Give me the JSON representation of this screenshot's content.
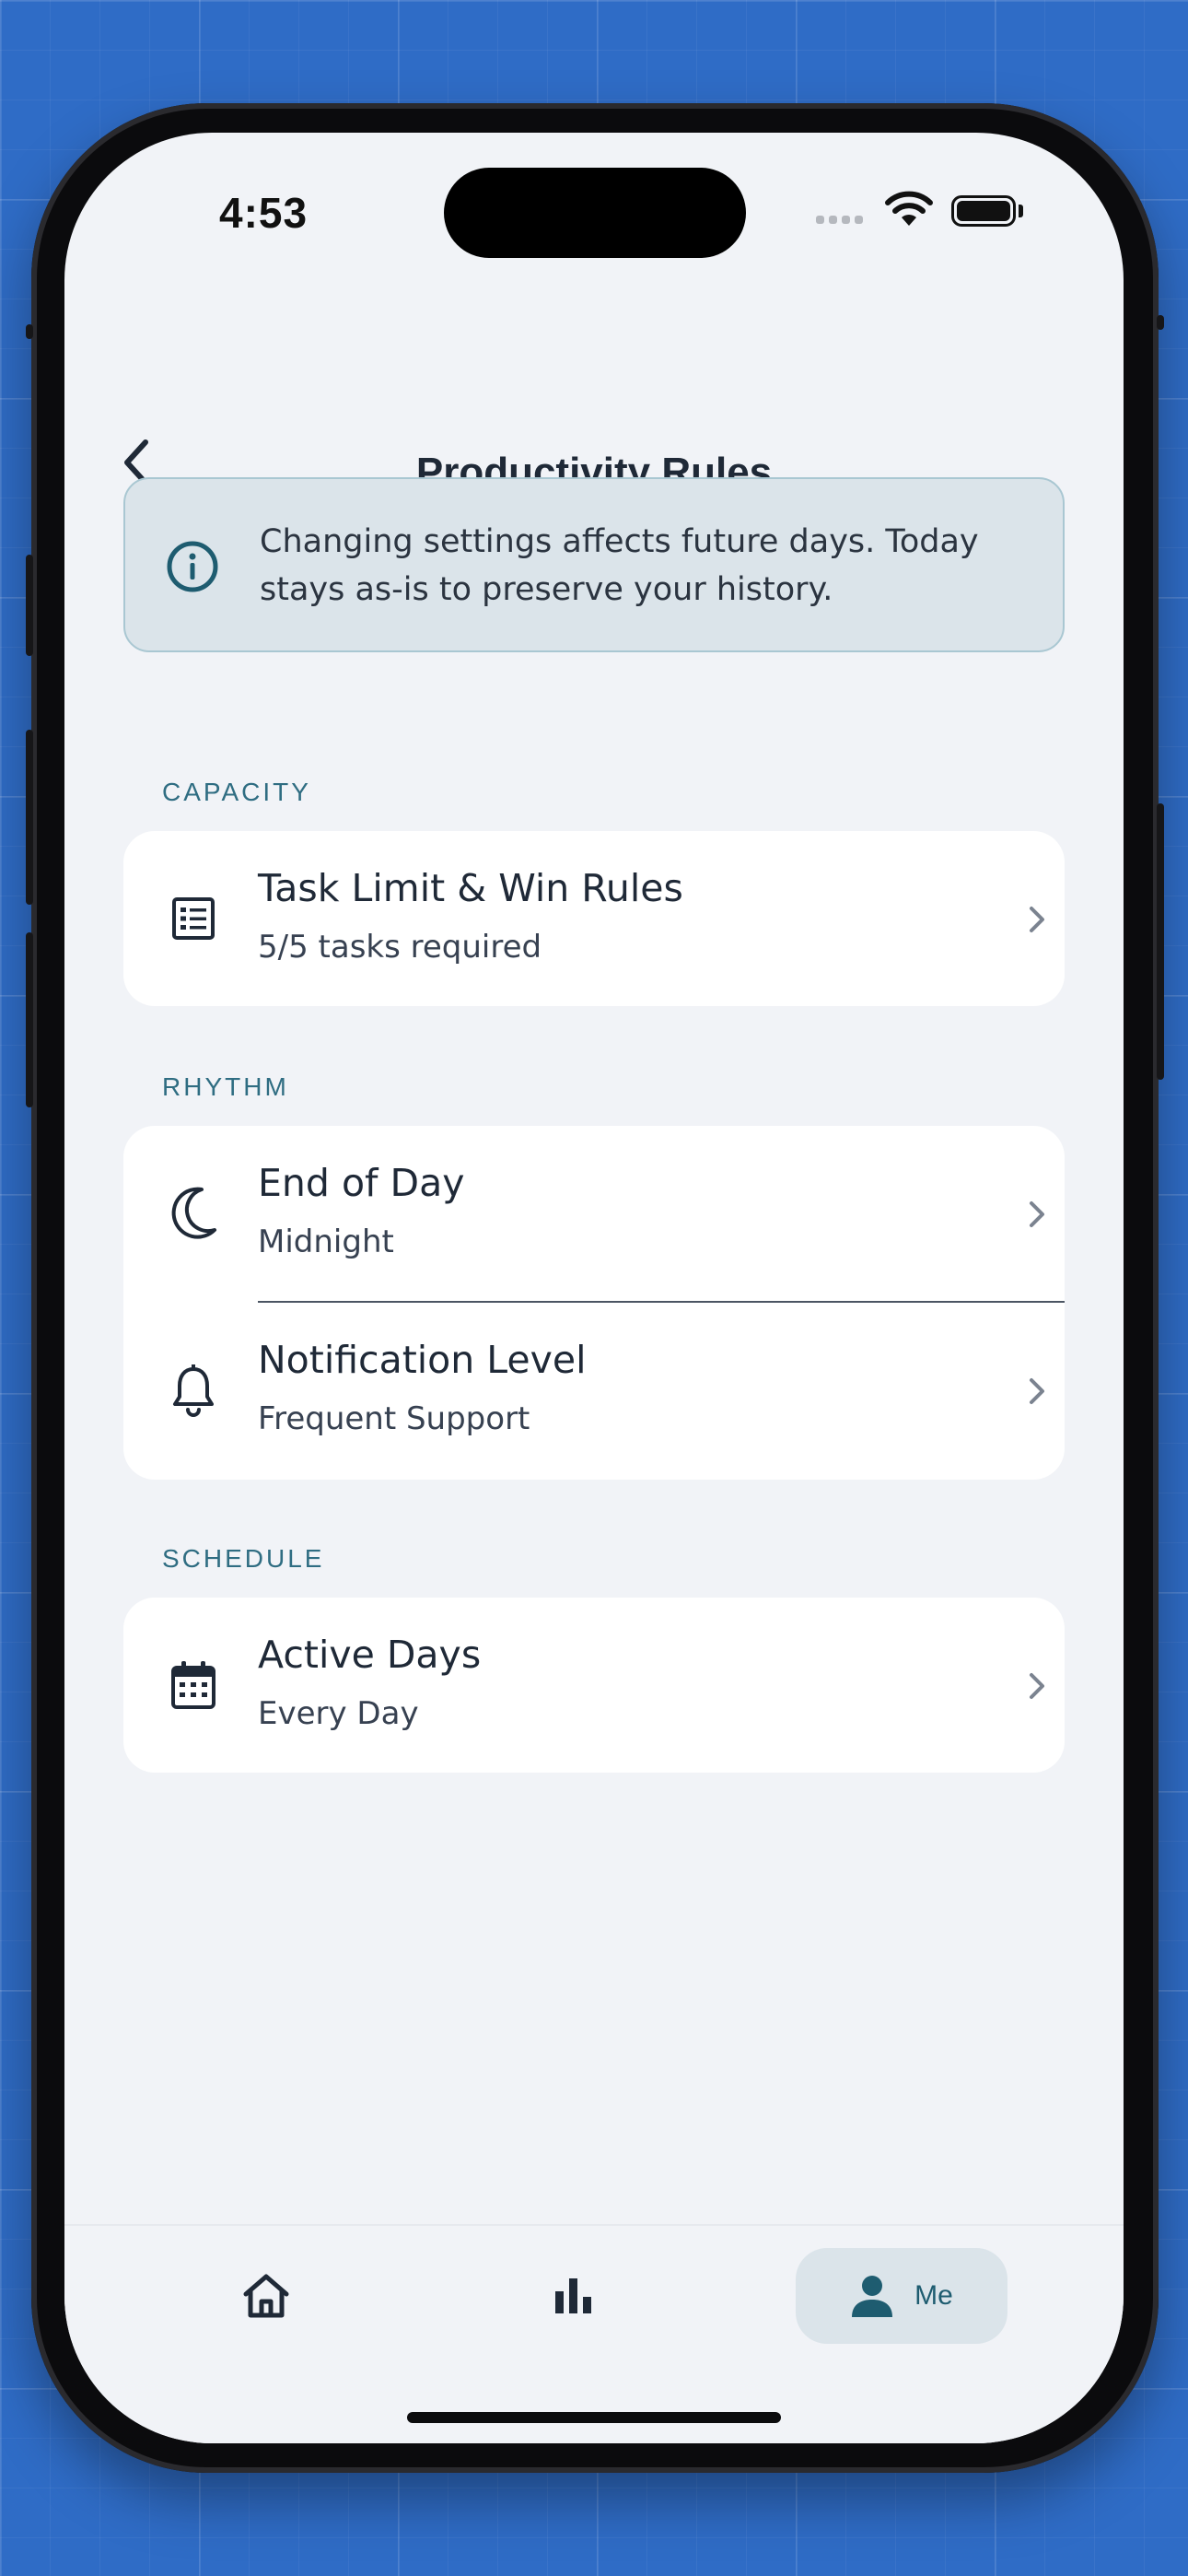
{
  "status_bar": {
    "time": "4:53"
  },
  "header": {
    "title": "Productivity Rules",
    "back_icon": "chevron-left-icon"
  },
  "info_banner": {
    "icon": "info-circle-icon",
    "text": "Changing settings affects future days. Today stays as-is to preserve your history."
  },
  "sections": {
    "capacity": {
      "label": "CAPACITY",
      "rows": [
        {
          "icon": "list-icon",
          "title": "Task Limit & Win Rules",
          "subtitle": "5/5 tasks required"
        }
      ]
    },
    "rhythm": {
      "label": "RHYTHM",
      "rows": [
        {
          "icon": "moon-icon",
          "title": "End of Day",
          "subtitle": "Midnight"
        },
        {
          "icon": "bell-icon",
          "title": "Notification Level",
          "subtitle": "Frequent Support"
        }
      ]
    },
    "schedule": {
      "label": "SCHEDULE",
      "rows": [
        {
          "icon": "calendar-icon",
          "title": "Active Days",
          "subtitle": "Every Day"
        }
      ]
    }
  },
  "tab_bar": {
    "tabs": [
      {
        "icon": "home-icon",
        "label": ""
      },
      {
        "icon": "bar-chart-icon",
        "label": ""
      },
      {
        "icon": "person-icon",
        "label": "Me",
        "selected": true
      }
    ]
  },
  "colors": {
    "accent": "#1e5c70",
    "section_label": "#2f6d82",
    "banner_bg": "#dbe4ea",
    "banner_border": "#a9c7d2",
    "screen_bg": "#f1f3f7"
  }
}
